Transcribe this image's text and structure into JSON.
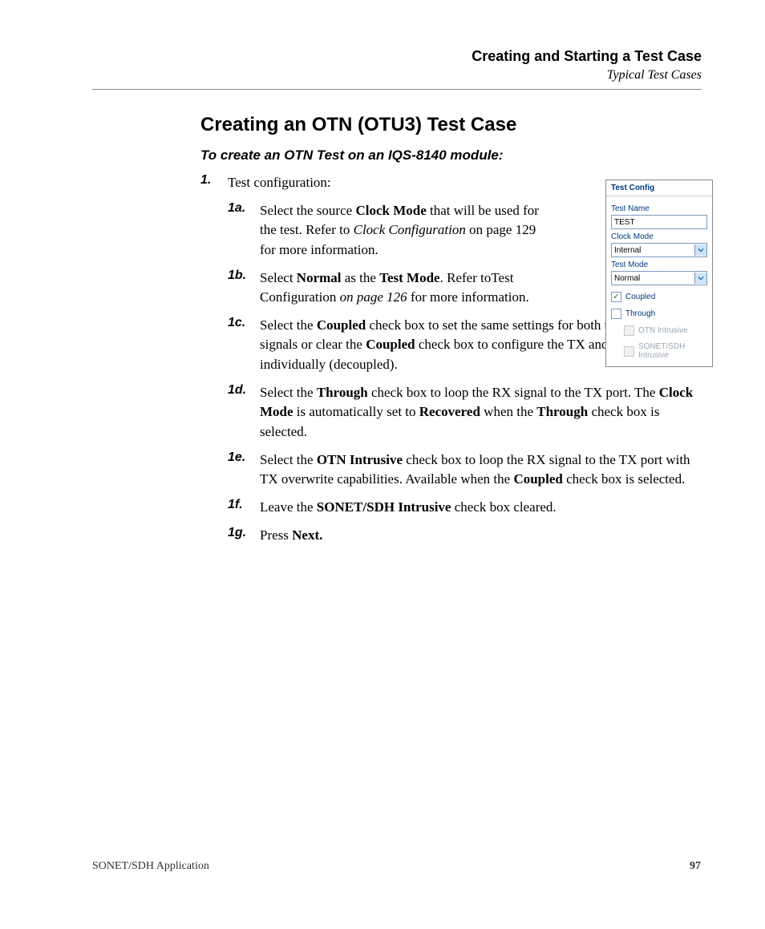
{
  "header": {
    "title": "Creating and Starting a Test Case",
    "subtitle": "Typical Test Cases"
  },
  "section_title": "Creating an OTN (OTU3) Test Case",
  "subtitle": "To create an OTN Test on an IQS-8140 module:",
  "step1": {
    "num": "1.",
    "text": "Test configuration:"
  },
  "steps": {
    "a": {
      "num": "1a.",
      "pre": "Select the source ",
      "b1": "Clock Mode",
      "mid1": " that will be used for the test. Refer to ",
      "i1": "Clock Configuration",
      "post": " on page 129 for more information."
    },
    "b": {
      "num": "1b.",
      "pre": "Select ",
      "b1": "Normal",
      "mid1": " as the ",
      "b2": "Test Mode",
      "mid2": ". Refer toTest Configuration ",
      "i1": "on page 126",
      "post": " for more information."
    },
    "c": {
      "num": "1c.",
      "pre": "Select the ",
      "b1": "Coupled",
      "mid1": " check box to set the same settings for both the TX and RX signals or clear the ",
      "b2": "Coupled",
      "post": " check box to configure the TX and RX signal individually (decoupled)."
    },
    "d": {
      "num": "1d.",
      "pre": "Select the ",
      "b1": "Through",
      "mid1": " check box to loop the RX signal to the TX port. The ",
      "b2": "Clock Mode",
      "mid2": " is automatically set to ",
      "b3": "Recovered",
      "mid3": " when the ",
      "b4": "Through",
      "post": " check box is selected."
    },
    "e": {
      "num": "1e.",
      "pre": "Select the ",
      "b1": "OTN Intrusive",
      "mid1": " check box to loop the RX signal to the TX port with TX overwrite capabilities. Available when the ",
      "b2": "Coupled",
      "post": " check box is selected."
    },
    "f": {
      "num": "1f.",
      "pre": "Leave the ",
      "b1": "SONET/SDH Intrusive",
      "post": " check box cleared."
    },
    "g": {
      "num": "1g.",
      "pre": "Press ",
      "b1": "Next.",
      "post": ""
    }
  },
  "panel": {
    "title": "Test Config",
    "test_name_label": "Test Name",
    "test_name_value": "TEST",
    "clock_mode_label": "Clock Mode",
    "clock_mode_value": "Internal",
    "test_mode_label": "Test Mode",
    "test_mode_value": "Normal",
    "coupled_label": "Coupled",
    "through_label": "Through",
    "otn_intrusive_label": "OTN Intrusive",
    "sonet_label": "SONET/SDH Intrusive"
  },
  "footer": {
    "left": "SONET/SDH Application",
    "right": "97"
  }
}
